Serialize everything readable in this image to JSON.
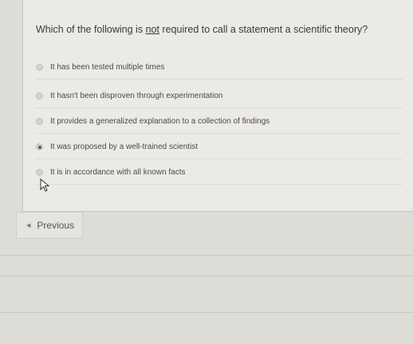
{
  "question": {
    "text_before": "Which of the following is ",
    "emphasis": "not",
    "text_after": " required to call a statement a scientific theory?"
  },
  "options": [
    {
      "label": "It has been tested multiple times",
      "selected": false
    },
    {
      "label": "It hasn't been disproven through experimentation",
      "selected": false
    },
    {
      "label": "It provides a generalized explanation to a collection of findings",
      "selected": false
    },
    {
      "label": "It was proposed by a well-trained scientist",
      "selected": true
    },
    {
      "label": "It is in accordance with all known facts",
      "selected": false
    }
  ],
  "navigation": {
    "previous_label": "Previous",
    "previous_icon": "triangle-left-icon"
  },
  "colors": {
    "background": "#dedcd7",
    "card": "#eceae6",
    "text": "#3a3a3a"
  }
}
